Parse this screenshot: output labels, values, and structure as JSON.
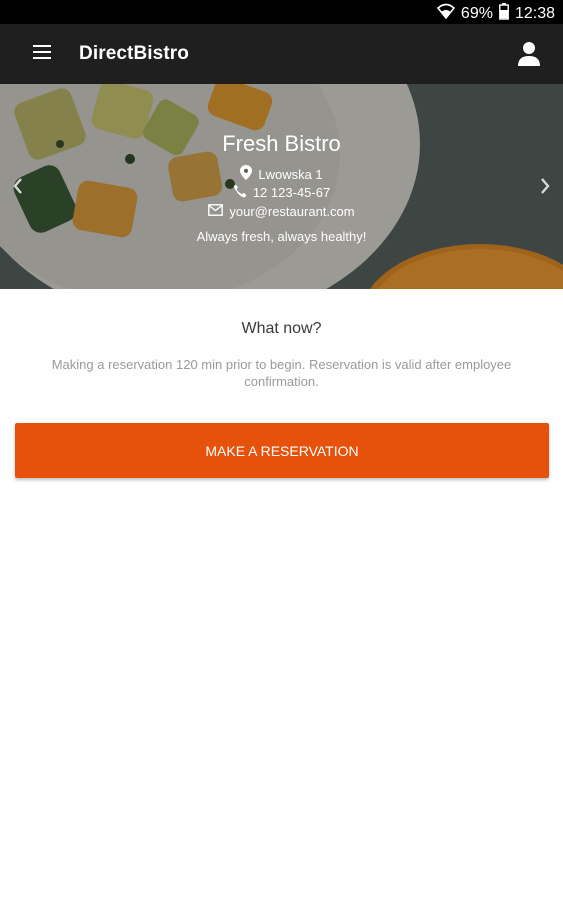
{
  "status_bar": {
    "battery": "69%",
    "time": "12:38",
    "icons": [
      "wifi-icon",
      "battery-icon"
    ]
  },
  "app_bar": {
    "title": "DirectBistro",
    "icons": [
      "menu-icon",
      "account-icon"
    ]
  },
  "restaurant": {
    "name": "Fresh Bistro",
    "address": "Lwowska 1",
    "phone": "12 123-45-67",
    "email": "your@restaurant.com",
    "tagline": "Always fresh, always healthy!",
    "icons": [
      "location-pin-icon",
      "phone-icon",
      "email-icon",
      "chevron-left-icon",
      "chevron-right-icon"
    ]
  },
  "main": {
    "title": "What now?",
    "description": "Making a reservation 120 min prior to begin. Reservation is valid after employee confirmation.",
    "reserve_button": "MAKE A RESERVATION"
  },
  "colors": {
    "accent": "#e6520b",
    "app_bar": "#1f1f1f",
    "status_bar": "#000000"
  }
}
